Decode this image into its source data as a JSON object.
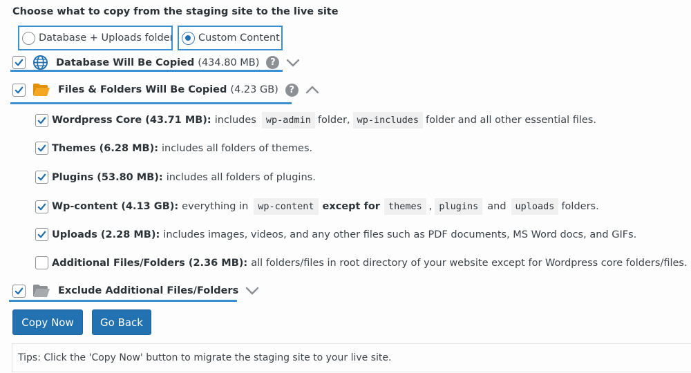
{
  "heading": "Choose what to copy from the staging site to the live site",
  "radios": {
    "db_uploads": "Database + Uploads folder",
    "custom": "Custom Content"
  },
  "database": {
    "title": "Database Will Be Copied",
    "size": "(434.80 MB)",
    "help": "?"
  },
  "files": {
    "title": "Files & Folders Will Be Copied",
    "size": "(4.23 GB)",
    "help": "?"
  },
  "items": {
    "core": {
      "label": "Wordpress Core (43.71 MB):",
      "t1": "includes",
      "c1": "wp-admin",
      "t2": "folder,",
      "c2": "wp-includes",
      "t3": "folder and all other essential files."
    },
    "themes": {
      "label": "Themes (6.28 MB):",
      "text": "includes all folders of themes."
    },
    "plugins": {
      "label": "Plugins (53.80 MB):",
      "text": "includes all folders of plugins."
    },
    "wpcontent": {
      "label": "Wp-content (4.13 GB):",
      "t1": "everything in",
      "c1": "wp-content",
      "bold": "except for",
      "c2": "themes",
      "sep": ",",
      "c3": "plugins",
      "and": "and",
      "c4": "uploads",
      "t2": "folders."
    },
    "uploads": {
      "label": "Uploads (2.28 MB):",
      "text": "includes images, videos, and any other files such as PDF documents, MS Word docs, and GIFs."
    },
    "additional": {
      "label": "Additional Files/Folders (2.36 MB):",
      "text": "all folders/files in root directory of your website except for Wordpress core folders/files."
    }
  },
  "exclude": {
    "title": "Exclude Additional Files/Folders"
  },
  "buttons": {
    "copy": "Copy Now",
    "back": "Go Back"
  },
  "tips": "Tips: Click the 'Copy Now' button to migrate the staging site to your live site.",
  "colors": {
    "accent": "#2271b1",
    "highlight_border": "#3a8fd0",
    "folder_orange": "#f0a30a",
    "folder_gray": "#8c8f94",
    "globe_blue": "#2271b1"
  }
}
